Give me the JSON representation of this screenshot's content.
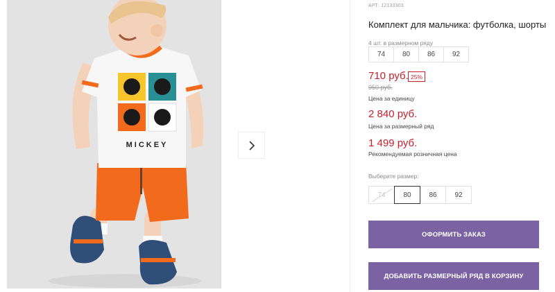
{
  "gallery": {
    "image_alt": "Boy wearing a white Mickey Mouse T-shirt and orange shorts",
    "tshirt_print_text": "MICKEY",
    "next_icon": "chevron-right-icon"
  },
  "product": {
    "article": "АРТ: 12133303",
    "title": "Комплект для мальчика: футболка, шорты",
    "pack_label": "4 шт. в размерном ряду",
    "pack_sizes": [
      "74",
      "80",
      "86",
      "92"
    ],
    "price": "710 руб.",
    "discount": "25%",
    "old_price": "950 руб.",
    "unit_label": "Цена за единицу",
    "set_price": "2 840 руб.",
    "set_label": "Цена за размерный ряд",
    "recommended_price": "1 499 руб.",
    "recommended_label": "Рекомендуемая розничная цена"
  },
  "size_picker": {
    "label": "Выберите размер:",
    "options": [
      {
        "label": "74",
        "state": "disabled"
      },
      {
        "label": "80",
        "state": "selected"
      },
      {
        "label": "86",
        "state": "available"
      },
      {
        "label": "92",
        "state": "available"
      }
    ]
  },
  "actions": {
    "order_label": "ОФОРМИТЬ ЗАКАЗ",
    "add_label": "ДОБАВИТЬ РАЗМЕРНЫЙ РЯД В КОРЗИНУ"
  },
  "colors": {
    "accent": "#7b62a3",
    "price_red": "#c8202a",
    "tshirt_trim": "#f26a1b",
    "shorts": "#f26a1b"
  }
}
